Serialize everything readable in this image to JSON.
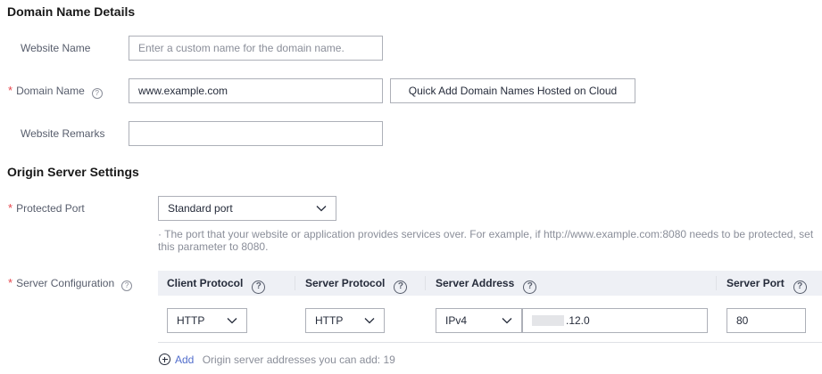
{
  "domain_section": {
    "title": "Domain Name Details",
    "website_name": {
      "label": "Website Name",
      "placeholder": "Enter a custom name for the domain name.",
      "value": ""
    },
    "domain_name": {
      "label": "Domain Name",
      "required_mark": "*",
      "value": "www.example.com",
      "help_glyph": "?"
    },
    "quick_add_button": "Quick Add Domain Names Hosted on Cloud",
    "website_remarks": {
      "label": "Website Remarks",
      "value": ""
    }
  },
  "origin_section": {
    "title": "Origin Server Settings",
    "protected_port": {
      "label": "Protected Port",
      "required_mark": "*",
      "value": "Standard port",
      "hint": "· The port that your website or application provides services over. For example, if http://www.example.com:8080 needs to be protected, set this parameter to 8080."
    },
    "server_configuration": {
      "label": "Server Configuration",
      "required_mark": "*",
      "help_glyph": "?",
      "columns": [
        "Client Protocol",
        "Server Protocol",
        "Server Address",
        "Server Port"
      ],
      "rows": [
        {
          "client_protocol": "HTTP",
          "server_protocol": "HTTP",
          "address_type": "IPv4",
          "address_suffix": ".12.0",
          "port": "80"
        }
      ],
      "add_link": "Add",
      "add_hint": "Origin server addresses you can add: 19"
    }
  },
  "colors": {
    "required": "#e6454c",
    "link": "#526ecc",
    "header_bg": "#eef0f5",
    "border": "#adb0b8"
  }
}
